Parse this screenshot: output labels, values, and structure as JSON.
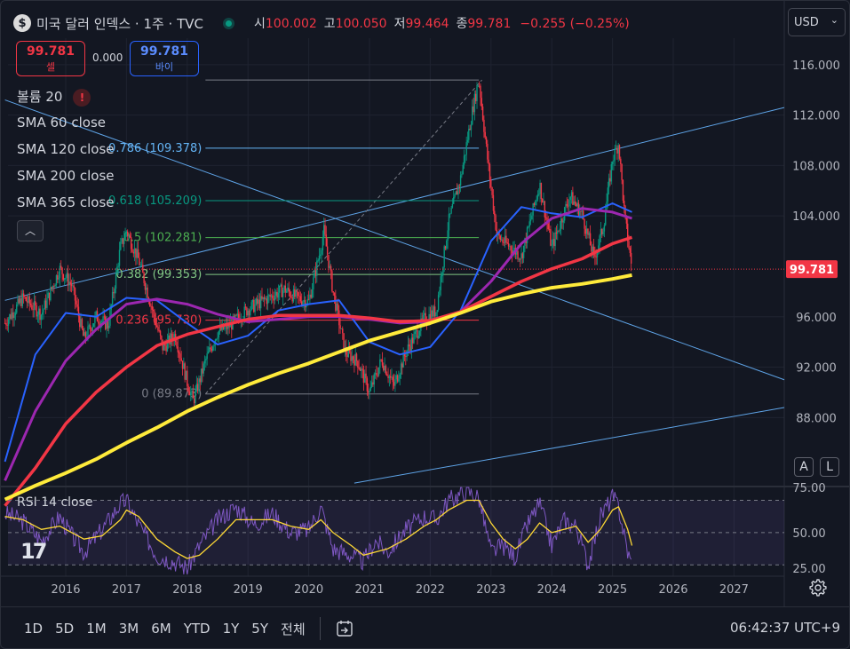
{
  "header": {
    "symbol_icon": "dollar-icon",
    "title": "미국 달러 인덱스 · 1주 · TVC",
    "open_label": "시",
    "open": "100.002",
    "high_label": "고",
    "high": "100.050",
    "low_label": "저",
    "low": "99.464",
    "close_label": "종",
    "close": "99.781",
    "change": "−0.255 (−0.25%)"
  },
  "trade": {
    "sell_price": "99.781",
    "sell_label": "셀",
    "spread": "0.000",
    "buy_price": "99.781",
    "buy_label": "바이"
  },
  "currency_selector": "USD",
  "indicators": {
    "volume": "볼륨 20",
    "sma60": "SMA 60 close",
    "sma120": "SMA 120 close",
    "sma200": "SMA 200 close",
    "sma365": "SMA 365 close",
    "rsi": "RSI 14 close"
  },
  "fib_labels": [
    "0.786 (109.378)",
    "0.618 (105.209)",
    "0.5 (102.281)",
    "0.382 (99.353)",
    "0.236 (95.730)",
    "0 (89.873)"
  ],
  "scale_buttons": {
    "auto": "A",
    "log": "L"
  },
  "toolbar": {
    "timeframes": [
      "1D",
      "5D",
      "1M",
      "3M",
      "6M",
      "YTD",
      "1Y",
      "5Y",
      "전체"
    ],
    "clock": "06:42:37 UTC+9"
  },
  "colors": {
    "background": "#131722",
    "up": "#089981",
    "down": "#f23645",
    "sma60": "#2962ff",
    "sma120": "#9c27b0",
    "sma200": "#f23645",
    "sma365": "#ffeb3b",
    "rsi": "#7e57c2",
    "rsi_ma": "#fdd835"
  },
  "chart_data": {
    "type": "line",
    "title": "미국 달러 인덱스 · 1주 · TVC",
    "x_axis_labels": [
      "2016",
      "2017",
      "2018",
      "2019",
      "2020",
      "2021",
      "2022",
      "2023",
      "2024",
      "2025",
      "2026",
      "2027"
    ],
    "y_axis_labels": [
      "116.000",
      "112.000",
      "108.000",
      "104.000",
      "96.000",
      "92.000",
      "88.000"
    ],
    "ylim": [
      82.6,
      118.1
    ],
    "last_price": 99.781,
    "last_price_label": "99.781",
    "fibonacci": {
      "levels": [
        0,
        0.236,
        0.382,
        0.5,
        0.618,
        0.786,
        1
      ],
      "prices": [
        89.873,
        95.73,
        99.353,
        102.281,
        105.209,
        109.378,
        114.78
      ],
      "labels": [
        "0 (89.873)",
        "0.236 (95.730)",
        "0.382 (99.353)",
        "0.5 (102.281)",
        "0.618 (105.209)",
        "0.786 (109.378)",
        ""
      ]
    },
    "price_series": {
      "name": "DXY",
      "x": [
        2015.0,
        2015.3,
        2015.6,
        2015.9,
        2016.1,
        2016.3,
        2016.5,
        2016.7,
        2016.9,
        2017.0,
        2017.2,
        2017.4,
        2017.6,
        2017.8,
        2018.0,
        2018.1,
        2018.3,
        2018.5,
        2018.7,
        2019.0,
        2019.3,
        2019.6,
        2019.8,
        2020.0,
        2020.2,
        2020.25,
        2020.4,
        2020.6,
        2020.8,
        2021.0,
        2021.2,
        2021.4,
        2021.6,
        2021.9,
        2022.1,
        2022.3,
        2022.5,
        2022.7,
        2022.8,
        2022.95,
        2023.1,
        2023.3,
        2023.5,
        2023.8,
        2024.0,
        2024.3,
        2024.5,
        2024.7,
        2024.85,
        2025.0,
        2025.1,
        2025.2,
        2025.32
      ],
      "values": [
        95.5,
        97.5,
        96.2,
        99.8,
        98.5,
        94.2,
        96.0,
        95.3,
        101.5,
        102.8,
        100.5,
        97.0,
        93.5,
        94.6,
        90.8,
        89.3,
        92.5,
        94.8,
        95.3,
        96.6,
        97.4,
        98.2,
        97.5,
        97.2,
        101.5,
        102.8,
        98.0,
        93.2,
        92.5,
        90.0,
        92.6,
        90.5,
        93.2,
        95.8,
        96.5,
        103.5,
        107.0,
        112.5,
        114.8,
        108.2,
        102.4,
        101.6,
        100.8,
        106.5,
        101.5,
        105.6,
        104.1,
        100.6,
        103.2,
        108.5,
        109.8,
        104.0,
        99.781
      ]
    },
    "sma_series": [
      {
        "name": "SMA 60 close",
        "x": [
          2015.0,
          2015.5,
          2016.0,
          2016.5,
          2017.0,
          2017.5,
          2018.0,
          2018.5,
          2019.0,
          2019.5,
          2020.0,
          2020.5,
          2021.0,
          2021.5,
          2022.0,
          2022.5,
          2023.0,
          2023.5,
          2024.0,
          2024.5,
          2025.0,
          2025.32
        ],
        "values": [
          84.5,
          93.0,
          96.3,
          96.0,
          97.5,
          97.3,
          95.5,
          93.8,
          94.5,
          96.5,
          97.0,
          97.3,
          94.0,
          93.0,
          93.6,
          96.5,
          102.0,
          104.7,
          104.2,
          103.9,
          105.0,
          104.3
        ]
      },
      {
        "name": "SMA 120 close",
        "x": [
          2015.0,
          2015.5,
          2016.0,
          2016.5,
          2017.0,
          2017.5,
          2018.0,
          2018.5,
          2019.0,
          2019.5,
          2020.0,
          2020.5,
          2021.0,
          2021.5,
          2022.0,
          2022.5,
          2023.0,
          2023.5,
          2024.0,
          2024.5,
          2025.0,
          2025.32
        ],
        "values": [
          83.0,
          88.5,
          92.5,
          95.0,
          97.0,
          97.4,
          97.0,
          96.2,
          95.6,
          95.8,
          96.0,
          96.0,
          95.8,
          95.5,
          95.6,
          96.4,
          98.8,
          101.8,
          103.8,
          104.6,
          104.3,
          103.8
        ]
      },
      {
        "name": "SMA 200 close",
        "x": [
          2015.0,
          2015.5,
          2016.0,
          2016.5,
          2017.0,
          2017.5,
          2018.0,
          2018.5,
          2019.0,
          2019.5,
          2020.0,
          2020.5,
          2021.0,
          2021.5,
          2022.0,
          2022.5,
          2023.0,
          2023.5,
          2024.0,
          2024.5,
          2025.0,
          2025.32
        ],
        "values": [
          81.0,
          84.0,
          87.5,
          90.0,
          92.0,
          93.7,
          94.6,
          95.2,
          95.8,
          96.1,
          96.1,
          96.1,
          95.9,
          95.6,
          95.7,
          96.4,
          97.6,
          98.8,
          99.8,
          100.6,
          101.8,
          102.3
        ]
      },
      {
        "name": "SMA 365 close",
        "x": [
          2015.0,
          2015.5,
          2016.0,
          2016.5,
          2017.0,
          2017.5,
          2018.0,
          2018.5,
          2019.0,
          2019.5,
          2020.0,
          2020.5,
          2021.0,
          2021.5,
          2022.0,
          2022.5,
          2023.0,
          2023.5,
          2024.0,
          2024.5,
          2025.0,
          2025.32
        ],
        "values": [
          81.5,
          82.6,
          83.6,
          84.7,
          86.0,
          87.2,
          88.5,
          89.6,
          90.6,
          91.5,
          92.3,
          93.2,
          94.1,
          94.8,
          95.5,
          96.3,
          97.2,
          97.8,
          98.3,
          98.6,
          99.0,
          99.3
        ]
      }
    ],
    "rsi": {
      "name": "RSI 14 close",
      "y_axis_labels": [
        "75.00",
        "50.00",
        "25.00"
      ],
      "ylim": [
        23,
        78
      ],
      "x": [
        2015.0,
        2015.3,
        2015.6,
        2015.9,
        2016.1,
        2016.3,
        2016.6,
        2016.9,
        2017.0,
        2017.2,
        2017.5,
        2017.8,
        2018.0,
        2018.2,
        2018.5,
        2018.8,
        2019.1,
        2019.4,
        2019.7,
        2020.0,
        2020.2,
        2020.4,
        2020.7,
        2020.9,
        2021.1,
        2021.3,
        2021.6,
        2021.9,
        2022.1,
        2022.3,
        2022.6,
        2022.8,
        2023.0,
        2023.2,
        2023.4,
        2023.6,
        2023.8,
        2024.0,
        2024.2,
        2024.4,
        2024.6,
        2024.8,
        2025.0,
        2025.1,
        2025.25,
        2025.32
      ],
      "values": [
        62,
        57,
        45,
        60,
        48,
        38,
        52,
        68,
        70,
        55,
        36,
        32,
        28,
        42,
        58,
        66,
        55,
        62,
        50,
        52,
        66,
        40,
        36,
        32,
        45,
        38,
        52,
        60,
        58,
        70,
        76,
        72,
        38,
        42,
        35,
        55,
        68,
        42,
        58,
        54,
        30,
        60,
        72,
        66,
        38,
        30
      ],
      "ma_values": [
        60,
        58,
        52,
        54,
        50,
        46,
        48,
        58,
        64,
        60,
        46,
        38,
        34,
        36,
        46,
        58,
        58,
        58,
        54,
        52,
        58,
        50,
        42,
        36,
        38,
        40,
        46,
        54,
        58,
        64,
        70,
        70,
        56,
        46,
        40,
        46,
        56,
        50,
        52,
        54,
        44,
        52,
        64,
        66,
        52,
        42
      ]
    }
  }
}
